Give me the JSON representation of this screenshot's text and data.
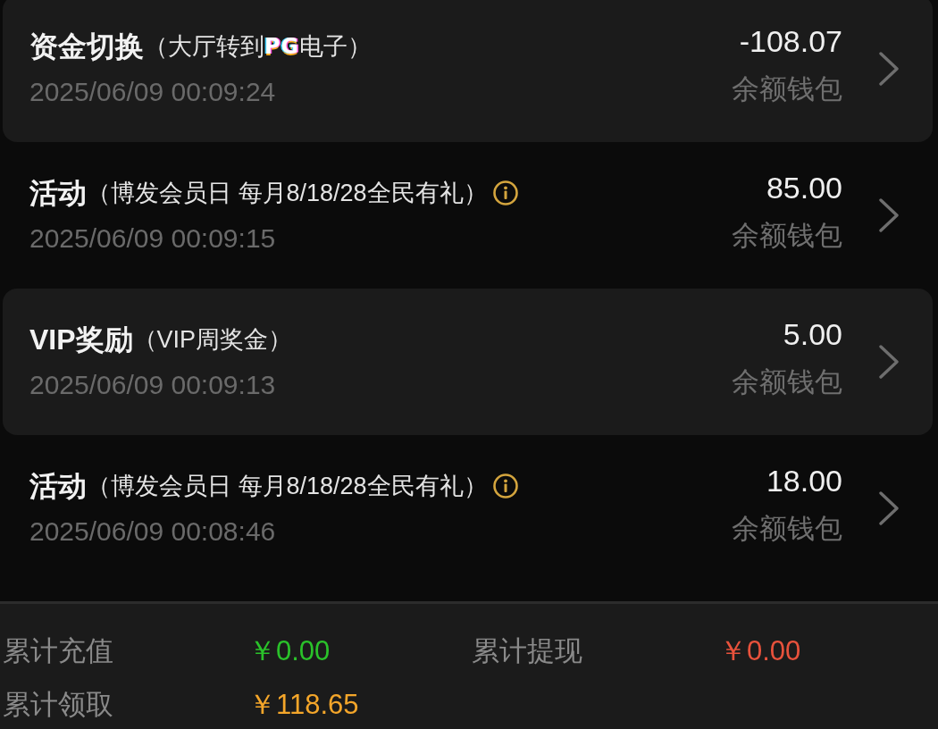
{
  "records": [
    {
      "title": "资金切换",
      "detail": [
        {
          "kind": "text",
          "text": "（大厅转到"
        },
        {
          "kind": "logo",
          "text": "PG"
        },
        {
          "kind": "text",
          "text": "电子）"
        }
      ],
      "info": false,
      "time": "2025/06/09 00:09:24",
      "amount": "-108.07",
      "wallet": "余额钱包"
    },
    {
      "title": "活动",
      "detail": [
        {
          "kind": "text",
          "text": "（博发会员日 每月8/18/28全民有礼）"
        }
      ],
      "info": true,
      "time": "2025/06/09 00:09:15",
      "amount": "85.00",
      "wallet": "余额钱包"
    },
    {
      "title": "VIP奖励",
      "detail": [
        {
          "kind": "text",
          "text": "（VIP周奖金）"
        }
      ],
      "info": false,
      "time": "2025/06/09 00:09:13",
      "amount": "5.00",
      "wallet": "余额钱包"
    },
    {
      "title": "活动",
      "detail": [
        {
          "kind": "text",
          "text": "（博发会员日 每月8/18/28全民有礼）"
        }
      ],
      "info": true,
      "time": "2025/06/09 00:08:46",
      "amount": "18.00",
      "wallet": "余额钱包"
    }
  ],
  "summary": {
    "items": [
      {
        "label": "累计充值",
        "value": "￥0.00",
        "color": "#2ac22a"
      },
      {
        "label": "累计提现",
        "value": "￥0.00",
        "color": "#e8523c"
      },
      {
        "label": "累计领取",
        "value": "￥118.65",
        "color": "#f4a62a"
      }
    ]
  }
}
